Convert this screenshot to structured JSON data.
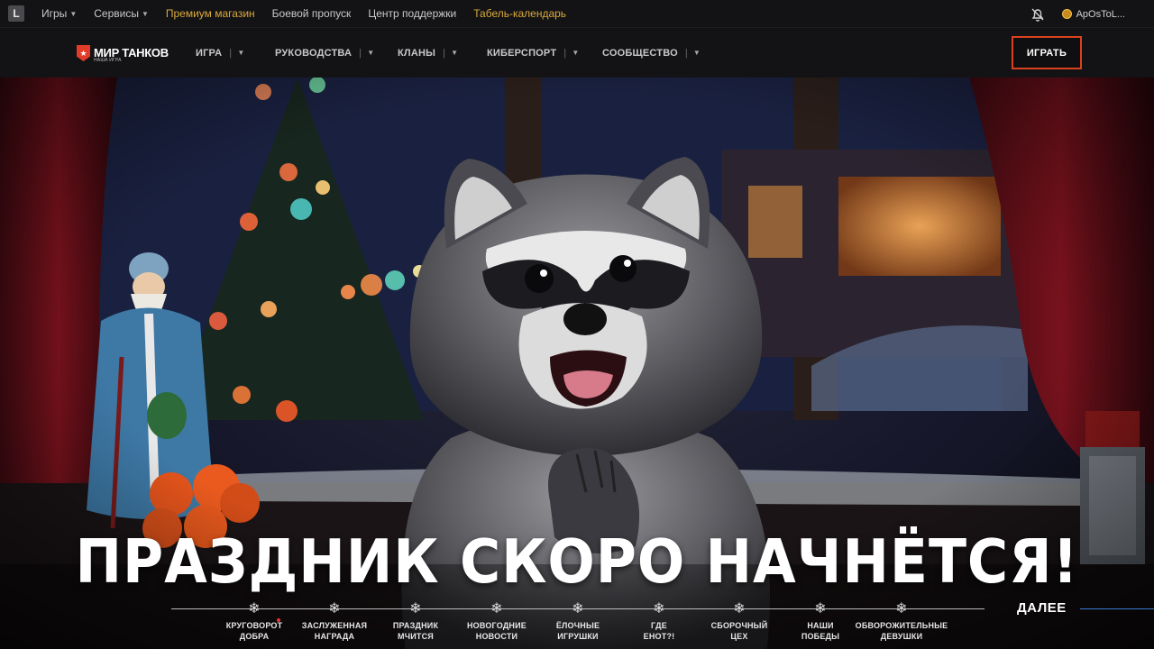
{
  "topbar": {
    "logo": "L",
    "games_label": "Игры",
    "services_label": "Сервисы",
    "premium_shop_label": "Премиум магазин",
    "battle_pass_label": "Боевой пропуск",
    "support_label": "Центр поддержки",
    "calendar_label": "Табель-календарь",
    "username": "ApOsToL...",
    "accent_color": "#d9a93c"
  },
  "nav": {
    "brand_title": "МИР ТАНКОВ",
    "brand_subtitle": "НАША ИГРА",
    "items": [
      {
        "label": "ИГРА"
      },
      {
        "label": "РУКОВОДСТВА"
      },
      {
        "label": "КЛАНЫ"
      },
      {
        "label": "КИБЕРСПОРТ"
      },
      {
        "label": "СООБЩЕСТВО"
      }
    ],
    "play_label": "ИГРАТЬ",
    "play_border_color": "#d8421f"
  },
  "hero": {
    "headline": "ПРАЗДНИК СКОРО НАЧНЁТСЯ!",
    "next_label": "ДАЛЕЕ",
    "timeline": [
      {
        "label": "КРУГОВОРОТ\nДОБРА",
        "icon": "snowflake-icon",
        "new": true
      },
      {
        "label": "ЗАСЛУЖЕННАЯ\nНАГРАДА",
        "icon": "snowflake-icon"
      },
      {
        "label": "ПРАЗДНИК\nМЧИТСЯ",
        "icon": "snowflake-icon"
      },
      {
        "label": "НОВОГОДНИЕ\nНОВОСТИ",
        "icon": "snowflake-icon"
      },
      {
        "label": "ЁЛОЧНЫЕ\nИГРУШКИ",
        "icon": "snowflake-icon"
      },
      {
        "label": "ГДЕ\nЕНОТ?!",
        "icon": "snowflake-icon"
      },
      {
        "label": "СБОРОЧНЫЙ\nЦЕХ",
        "icon": "snowflake-icon"
      },
      {
        "label": "НАШИ\nПОБЕДЫ",
        "icon": "snowflake-icon"
      },
      {
        "label": "ОБВОРОЖИТЕЛЬНЫЕ\nДЕВУШКИ",
        "icon": "snowflake-icon"
      }
    ]
  }
}
